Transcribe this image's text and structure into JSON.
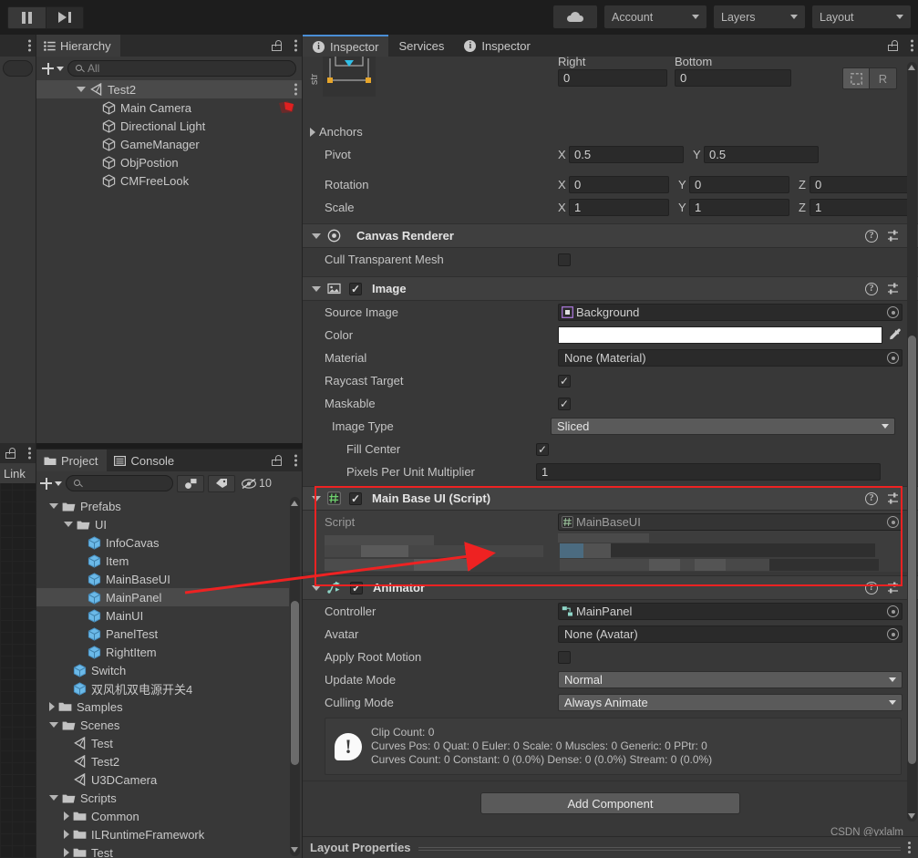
{
  "toolbar": {
    "pause_label": "pause-button",
    "step_label": "step-button",
    "cloud_label": "cloud-services",
    "account": "Account",
    "layers": "Layers",
    "layout": "Layout"
  },
  "hierarchy": {
    "tab": "Hierarchy",
    "search_placeholder": "All",
    "search_value": "",
    "items": [
      {
        "label": "Test2",
        "type": "scene",
        "indent": 0,
        "selected": true,
        "expanded": true
      },
      {
        "label": "Main Camera",
        "type": "gameobject",
        "indent": 1,
        "selected": false,
        "badge": "camera-preview"
      },
      {
        "label": "Directional Light",
        "type": "gameobject",
        "indent": 1,
        "selected": false
      },
      {
        "label": "GameManager",
        "type": "gameobject",
        "indent": 1,
        "selected": false
      },
      {
        "label": "ObjPostion",
        "type": "gameobject",
        "indent": 1,
        "selected": false
      },
      {
        "label": "CMFreeLook",
        "type": "gameobject",
        "indent": 1,
        "selected": false
      }
    ]
  },
  "leftpanel": {
    "tab": "Link"
  },
  "project": {
    "tab": "Project",
    "console_tab": "Console",
    "search_value": "",
    "hidden_count": "10",
    "items": [
      {
        "label": "Prefabs",
        "type": "folder-open",
        "indent": 1,
        "arrow": "down",
        "selected": false
      },
      {
        "label": "UI",
        "type": "folder-open",
        "indent": 2,
        "arrow": "down",
        "selected": false
      },
      {
        "label": "InfoCavas",
        "type": "prefab",
        "indent": 3,
        "arrow": "none",
        "selected": false
      },
      {
        "label": "Item",
        "type": "prefab",
        "indent": 3,
        "arrow": "none",
        "selected": false
      },
      {
        "label": "MainBaseUI",
        "type": "prefab",
        "indent": 3,
        "arrow": "none",
        "selected": false
      },
      {
        "label": "MainPanel",
        "type": "prefab",
        "indent": 3,
        "arrow": "none",
        "selected": true
      },
      {
        "label": "MainUI",
        "type": "prefab",
        "indent": 3,
        "arrow": "none",
        "selected": false
      },
      {
        "label": "PanelTest",
        "type": "prefab",
        "indent": 3,
        "arrow": "none",
        "selected": false
      },
      {
        "label": "RightItem",
        "type": "prefab",
        "indent": 3,
        "arrow": "none",
        "selected": false
      },
      {
        "label": "Switch",
        "type": "prefab",
        "indent": 2,
        "arrow": "none",
        "selected": false
      },
      {
        "label": "双风机双电源开关4",
        "type": "prefab",
        "indent": 2,
        "arrow": "none",
        "selected": false
      },
      {
        "label": "Samples",
        "type": "folder",
        "indent": 1,
        "arrow": "right",
        "selected": false
      },
      {
        "label": "Scenes",
        "type": "folder-open",
        "indent": 1,
        "arrow": "down",
        "selected": false
      },
      {
        "label": "Test",
        "type": "scene",
        "indent": 2,
        "arrow": "none",
        "selected": false
      },
      {
        "label": "Test2",
        "type": "scene",
        "indent": 2,
        "arrow": "none",
        "selected": false
      },
      {
        "label": "U3DCamera",
        "type": "scene",
        "indent": 2,
        "arrow": "none",
        "selected": false
      },
      {
        "label": "Scripts",
        "type": "folder-open",
        "indent": 1,
        "arrow": "down",
        "selected": false
      },
      {
        "label": "Common",
        "type": "folder",
        "indent": 2,
        "arrow": "right",
        "selected": false
      },
      {
        "label": "ILRuntimeFramework",
        "type": "folder",
        "indent": 2,
        "arrow": "right",
        "selected": false
      },
      {
        "label": "Test",
        "type": "folder",
        "indent": 2,
        "arrow": "right",
        "selected": false
      }
    ]
  },
  "inspector": {
    "tabs": [
      {
        "label": "Inspector",
        "active": true
      },
      {
        "label": "Services",
        "active": false
      },
      {
        "label": "Inspector",
        "active": false
      }
    ],
    "rect_transform": {
      "vertical_label": "str",
      "right_label": "Right",
      "right_value": "0",
      "bottom_label": "Bottom",
      "bottom_value": "0",
      "blueprint_btn": "blueprint-mode",
      "raw_btn": "R",
      "anchors_label": "Anchors",
      "pivot_label": "Pivot",
      "pivot_x_axis": "X",
      "pivot_x": "0.5",
      "pivot_y_axis": "Y",
      "pivot_y": "0.5",
      "rotation_label": "Rotation",
      "rot_x_axis": "X",
      "rot_x": "0",
      "rot_y_axis": "Y",
      "rot_y": "0",
      "rot_z_axis": "Z",
      "rot_z": "0",
      "scale_label": "Scale",
      "scale_x_axis": "X",
      "scale_x": "1",
      "scale_y_axis": "Y",
      "scale_y": "1",
      "scale_z_axis": "Z",
      "scale_z": "1"
    },
    "canvas_renderer": {
      "title": "Canvas Renderer",
      "cull_label": "Cull Transparent Mesh",
      "cull_checked": ""
    },
    "image": {
      "title": "Image",
      "enabled": "✓",
      "source_image_label": "Source Image",
      "source_image_value": "Background",
      "color_label": "Color",
      "color_value": "#FFFFFF",
      "material_label": "Material",
      "material_value": "None (Material)",
      "raycast_label": "Raycast Target",
      "raycast_checked": "✓",
      "maskable_label": "Maskable",
      "maskable_checked": "✓",
      "image_type_label": "Image Type",
      "image_type_value": "Sliced",
      "fill_center_label": "Fill Center",
      "fill_center_checked": "✓",
      "pixels_label": "Pixels Per Unit Multiplier",
      "pixels_value": "1"
    },
    "main_base_ui": {
      "title": "Main Base UI (Script)",
      "enabled": "✓",
      "script_label": "Script",
      "script_value": "MainBaseUI",
      "highlight_color": "#ee2222"
    },
    "animator": {
      "title": "Animator",
      "enabled": "✓",
      "controller_label": "Controller",
      "controller_value": "MainPanel",
      "avatar_label": "Avatar",
      "avatar_value": "None (Avatar)",
      "root_motion_label": "Apply Root Motion",
      "root_motion_checked": "",
      "update_mode_label": "Update Mode",
      "update_mode_value": "Normal",
      "culling_mode_label": "Culling Mode",
      "culling_mode_value": "Always Animate",
      "info_line1": "Clip Count: 0",
      "info_line2": "Curves Pos: 0 Quat: 0 Euler: 0 Scale: 0 Muscles: 0 Generic: 0 PPtr: 0",
      "info_line3": "Curves Count: 0 Constant: 0 (0.0%) Dense: 0 (0.0%) Stream: 0 (0.0%)"
    },
    "add_component": "Add Component",
    "watermark": "CSDN @yxlalm",
    "layout_properties": "Layout Properties"
  }
}
